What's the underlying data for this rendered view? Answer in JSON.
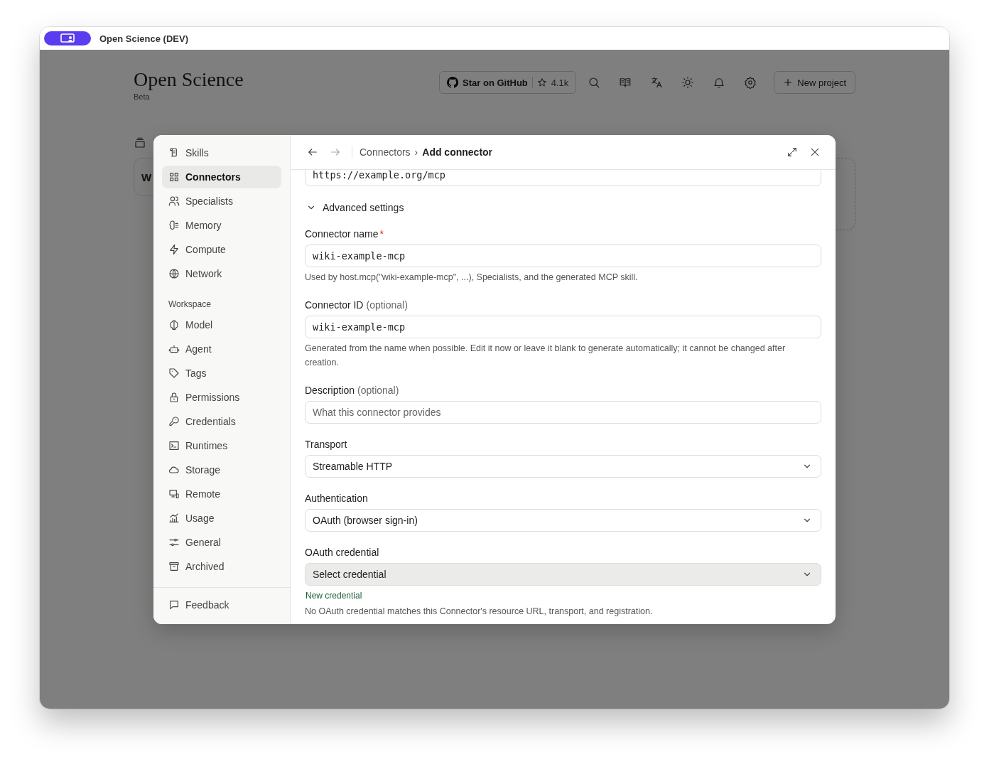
{
  "window": {
    "title": "Open Science (DEV)"
  },
  "app_header": {
    "title": "Open Science",
    "subtitle": "Beta",
    "github_button": {
      "label": "Star on GitHub",
      "stars": "4.1k"
    },
    "new_project_button": "New project"
  },
  "background": {
    "card_title": "W"
  },
  "dialog": {
    "sidebar": {
      "groups": [
        {
          "items": [
            {
              "label": "Skills",
              "selected": false
            },
            {
              "label": "Connectors",
              "selected": true
            },
            {
              "label": "Specialists",
              "selected": false
            },
            {
              "label": "Memory",
              "selected": false
            },
            {
              "label": "Compute",
              "selected": false
            },
            {
              "label": "Network",
              "selected": false
            }
          ]
        },
        {
          "heading": "Workspace",
          "items": [
            {
              "label": "Model",
              "selected": false
            },
            {
              "label": "Agent",
              "selected": false
            },
            {
              "label": "Tags",
              "selected": false
            },
            {
              "label": "Permissions",
              "selected": false
            },
            {
              "label": "Credentials",
              "selected": false
            },
            {
              "label": "Runtimes",
              "selected": false
            },
            {
              "label": "Storage",
              "selected": false
            },
            {
              "label": "Remote",
              "selected": false
            },
            {
              "label": "Usage",
              "selected": false
            },
            {
              "label": "General",
              "selected": false
            },
            {
              "label": "Archived",
              "selected": false
            }
          ]
        }
      ],
      "footer": "Feedback"
    },
    "breadcrumb": {
      "parent": "Connectors",
      "separator": "›",
      "current": "Add connector"
    },
    "url_field": {
      "value": "https://example.org/mcp"
    },
    "advanced": {
      "label": "Advanced settings",
      "expanded": true
    },
    "fields": [
      {
        "kind": "input",
        "label": "Connector name",
        "required_mark": "*",
        "value": "wiki-example-mcp",
        "help": "Used by host.mcp(\"wiki-example-mcp\", ...), Specialists, and the generated MCP skill."
      },
      {
        "kind": "input",
        "label": "Connector ID",
        "optional": "(optional)",
        "value": "wiki-example-mcp",
        "help": "Generated from the name when possible. Edit it now or leave it blank to generate automatically; it cannot be changed after creation."
      },
      {
        "kind": "text",
        "label": "Description",
        "optional": "(optional)",
        "placeholder": "What this connector provides"
      },
      {
        "kind": "select",
        "label": "Transport",
        "value": "Streamable HTTP",
        "disabled": false
      },
      {
        "kind": "select",
        "label": "Authentication",
        "value": "OAuth (browser sign-in)",
        "disabled": false
      },
      {
        "kind": "select",
        "label": "OAuth credential",
        "value": "Select credential",
        "disabled": true,
        "link": "New credential",
        "help": "No OAuth credential matches this Connector's resource URL, transport, and registration."
      }
    ]
  }
}
